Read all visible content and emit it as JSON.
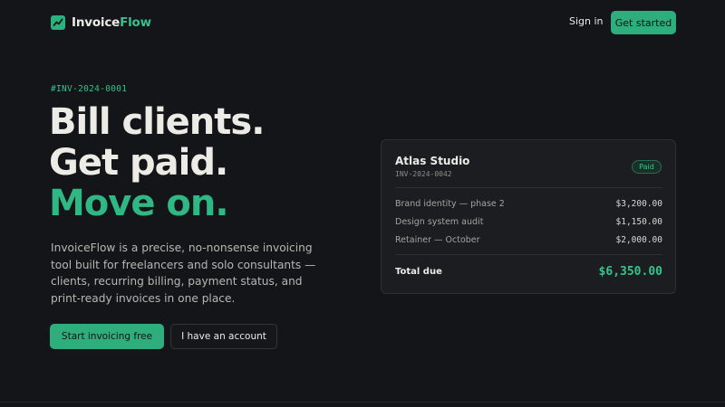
{
  "nav": {
    "brand_part1": "Invoice",
    "brand_part2": "Flow",
    "sign_in": "Sign in",
    "get_started": "Get started",
    "logo_icon": "trend-line-icon"
  },
  "hero": {
    "eyebrow": "#INV-2024-0001",
    "headline_line1": "Bill clients.",
    "headline_line2": "Get paid.",
    "headline_line3": "Move on.",
    "description": "InvoiceFlow is a precise, no-nonsense invoicing tool built for freelancers and solo consultants — clients, recurring billing, payment status, and print-ready invoices in one place.",
    "primary_cta": "Start invoicing free",
    "secondary_cta": "I have an account"
  },
  "invoice_card": {
    "client": "Atlas Studio",
    "invoice_number": "INV-2024-0042",
    "status": "Paid",
    "line_items": [
      {
        "description": "Brand identity — phase 2",
        "amount": "$3,200.00"
      },
      {
        "description": "Design system audit",
        "amount": "$1,150.00"
      },
      {
        "description": "Retainer — October",
        "amount": "$2,000.00"
      }
    ],
    "total_label": "Total due",
    "total_value": "$6,350.00"
  },
  "colors": {
    "background": "#141518",
    "accent": "#2ead7d",
    "accent_text": "#34c28c",
    "card": "#1b1d21",
    "text": "#ecebe6",
    "muted_text": "#b7b7b2"
  }
}
